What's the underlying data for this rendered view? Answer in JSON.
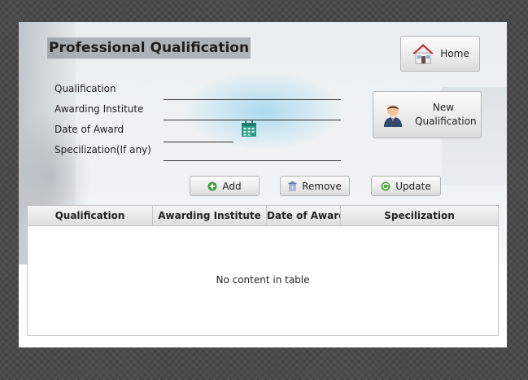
{
  "page": {
    "title": "Professional Qualification"
  },
  "form": {
    "fields": [
      {
        "label": "Qualification",
        "value": ""
      },
      {
        "label": "Awarding Institute",
        "value": ""
      },
      {
        "label": "Date of Award",
        "value": ""
      },
      {
        "label": "Specilization(If any)",
        "value": ""
      }
    ]
  },
  "buttons": {
    "home": "Home",
    "new_qualification_line1": "New",
    "new_qualification_line2": "Qualification",
    "add": "Add",
    "remove": "Remove",
    "update": "Update"
  },
  "table": {
    "columns": [
      "Qualification",
      "Awarding Institute",
      "Date of Award",
      "Specilization"
    ],
    "rows": [],
    "empty_message": "No content in table"
  },
  "icons": {
    "home": "home-icon",
    "new_qualification": "person-icon",
    "calendar": "calendar-icon",
    "add": "plus-circle-icon",
    "remove": "trash-icon",
    "update": "refresh-icon"
  },
  "colors": {
    "add_icon": "#3f9a3a",
    "update_icon": "#4aa83a",
    "remove_icon": "#6b7fb8",
    "calendar_icon": "#2e9b86",
    "home_roof": "#c62828"
  }
}
